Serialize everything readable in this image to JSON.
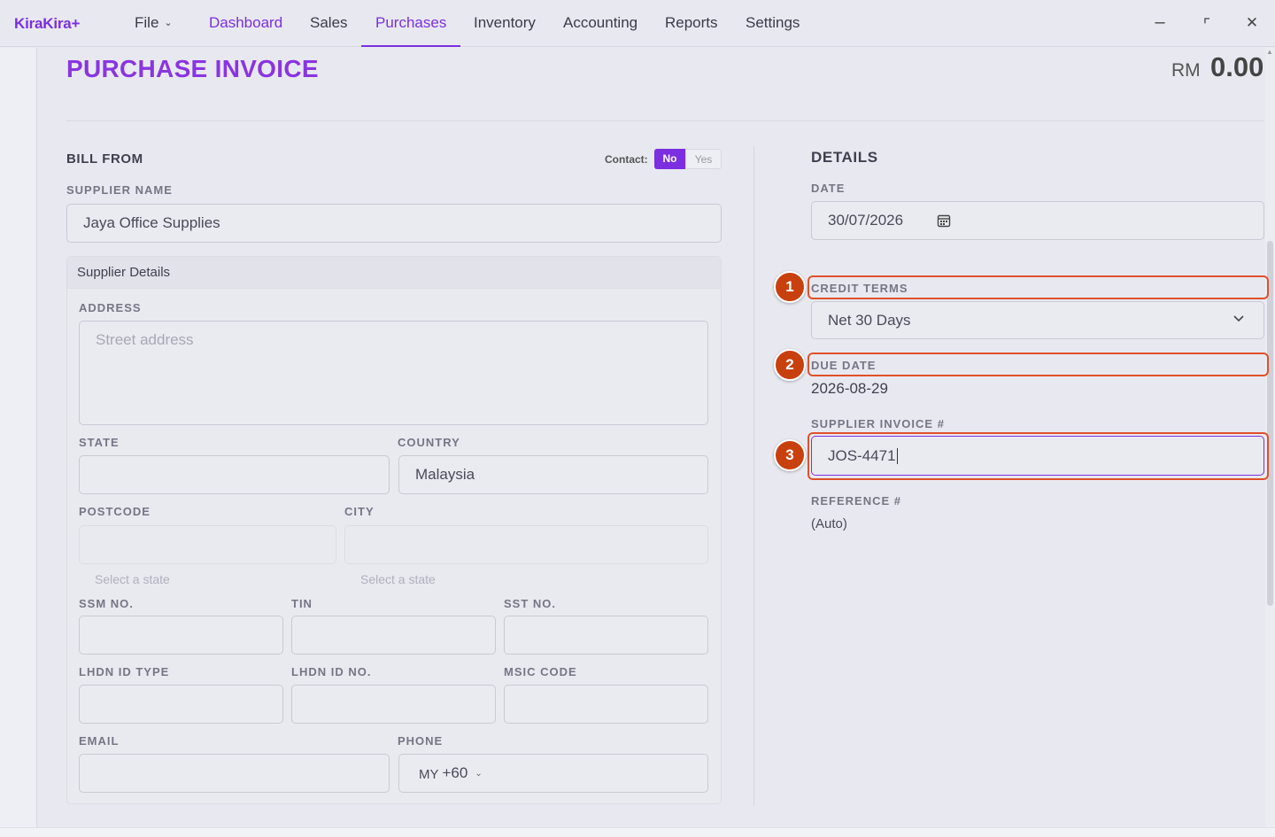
{
  "app": {
    "brand": "KiraKira+"
  },
  "nav": {
    "file": "File",
    "items": [
      "Dashboard",
      "Sales",
      "Purchases",
      "Inventory",
      "Accounting",
      "Reports",
      "Settings"
    ],
    "active": "Purchases"
  },
  "window": {
    "minimize": "–",
    "maximize": "⌜",
    "close": "✕"
  },
  "header": {
    "title": "PURCHASE INVOICE",
    "currency": "RM",
    "total": "0.00"
  },
  "bill_from": {
    "heading": "BILL FROM",
    "contact_label": "Contact:",
    "contact_no": "No",
    "contact_yes": "Yes",
    "supplier_name_label": "SUPPLIER NAME",
    "supplier_name_value": "Jaya Office Supplies",
    "details_box_title": "Supplier Details",
    "address_label": "ADDRESS",
    "address_placeholder": "Street address",
    "state_label": "STATE",
    "state_value": "",
    "country_label": "COUNTRY",
    "country_value": "Malaysia",
    "postcode_label": "POSTCODE",
    "postcode_hint": "Select a state",
    "city_label": "CITY",
    "city_hint": "Select a state",
    "ssm_label": "SSM NO.",
    "tin_label": "TIN",
    "sst_label": "SST NO.",
    "lhdn_type_label": "LHDN ID TYPE",
    "lhdn_no_label": "LHDN ID NO.",
    "msic_label": "MSIC CODE",
    "email_label": "EMAIL",
    "phone_label": "PHONE",
    "phone_country": "MY",
    "phone_code": "+60"
  },
  "details": {
    "heading": "DETAILS",
    "date_label": "DATE",
    "date_value": "30/07/2026",
    "credit_terms_label": "CREDIT TERMS",
    "credit_terms_value": "Net 30 Days",
    "due_date_label": "DUE DATE",
    "due_date_value": "2026-08-29",
    "supplier_invoice_label": "SUPPLIER INVOICE #",
    "supplier_invoice_value": "JOS-4471",
    "reference_label": "REFERENCE #",
    "reference_value": "(Auto)"
  },
  "annotations": [
    "1",
    "2",
    "3"
  ],
  "colors": {
    "accent": "#7b2fe0",
    "annotation": "#c9400f",
    "highlight_border": "#e0502a"
  },
  "icons": {
    "calendar": "calendar-icon",
    "dropdown": "chevron-down-icon"
  }
}
